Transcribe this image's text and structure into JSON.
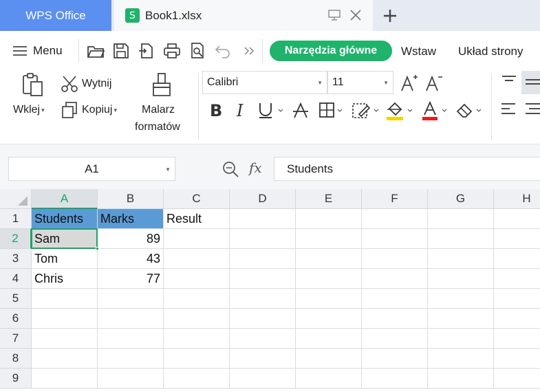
{
  "tabs": {
    "app_tab": "WPS Office",
    "doc_tab": "Book1.xlsx",
    "doc_logo": "S"
  },
  "menu": {
    "menu_label": "Menu",
    "active_tab": "Narzędzia główne",
    "tabs": [
      "Wstaw",
      "Układ strony"
    ]
  },
  "ribbon": {
    "paste": "Wklej",
    "cut": "Wytnij",
    "copy": "Kopiuj",
    "format_painter_line1": "Malarz",
    "format_painter_line2": "formatów",
    "font_name": "Calibri",
    "font_size": "11"
  },
  "formula_bar": {
    "name_box": "A1",
    "fx": "fx",
    "content": "Students"
  },
  "grid": {
    "columns": [
      "A",
      "B",
      "C",
      "D",
      "E",
      "F",
      "G",
      "H"
    ],
    "rows": [
      "1",
      "2",
      "3",
      "4",
      "5",
      "6",
      "7",
      "8",
      "9"
    ],
    "cells": {
      "A1": "Students",
      "B1": "Marks",
      "C1": "Result",
      "A2": "Sam",
      "B2": "89",
      "A3": "Tom",
      "B3": "43",
      "A4": "Chris",
      "B4": "77"
    },
    "selected_cell": "A2"
  },
  "colors": {
    "brand_blue": "#5b8ff0",
    "accent_green": "#1fb36b",
    "header_fill": "#5b9bd5",
    "underline_yellow": "#f5d300",
    "underline_red": "#e02020"
  }
}
